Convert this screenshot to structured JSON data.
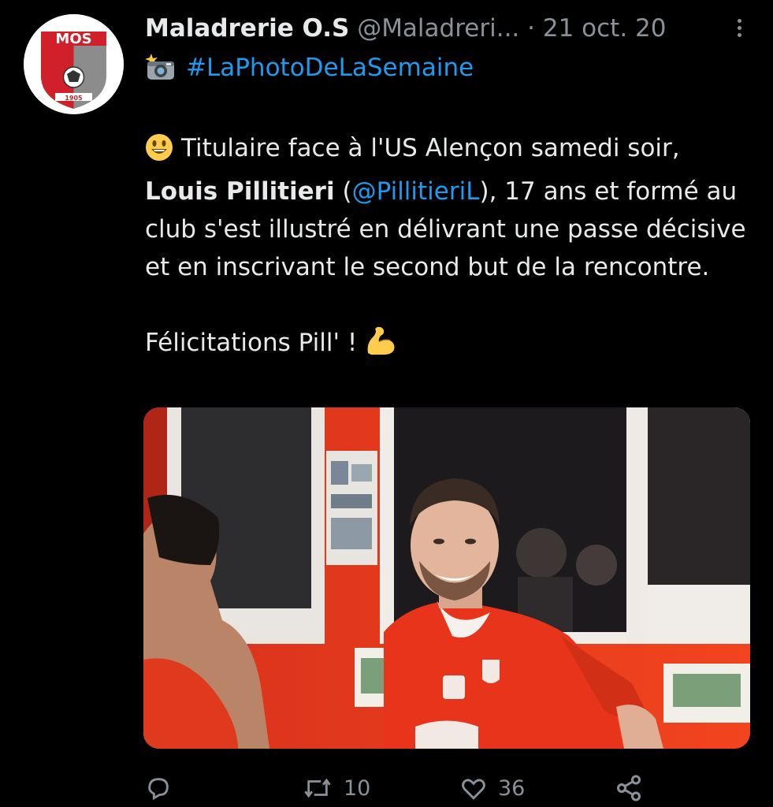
{
  "tweet": {
    "display_name": "Maladrerie O.S",
    "handle": "@Maladreri...",
    "separator": "·",
    "date": "21 oct. 20",
    "hashtag": "#LaPhotoDeLaSemaine",
    "body": {
      "line1_text": "Titulaire face à l'US Alençon samedi soir,",
      "player_name": "Louis Pillitieri",
      "paren_open": " (",
      "mention": "@PillitieriL",
      "after_mention": "), 17 ans et formé au club s'est illustré en délivrant une passe décisive et en inscrivant le second but de la rencontre.",
      "congrats": "Félicitations Pill' !"
    },
    "avatar": {
      "logo_text": "MOS",
      "year": "1905",
      "colors": {
        "red": "#d0202a",
        "gray": "#8c8c8c"
      }
    },
    "actions": {
      "retweets": "10",
      "likes": "36"
    },
    "icons": [
      "comment-icon",
      "retweet-icon",
      "like-icon",
      "share-icon",
      "camera-flash-icon",
      "smiley-emoji-icon",
      "flexed-biceps-icon",
      "more-options-icon"
    ],
    "accent_color": "#1d9bf0"
  }
}
